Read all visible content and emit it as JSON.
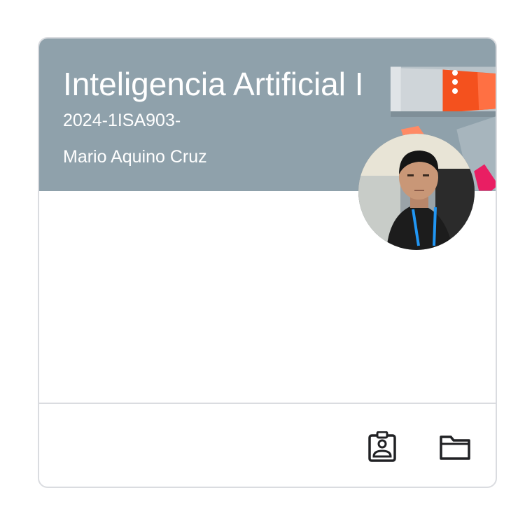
{
  "course": {
    "title": "Inteligencia Artificial I",
    "section": "2024-1ISA903-",
    "teacher": "Mario Aquino Cruz"
  },
  "icons": {
    "more": "more-vert-icon",
    "avatar": "teacher-avatar",
    "assignments": "assignment-ind-icon",
    "folder": "folder-icon"
  },
  "colors": {
    "banner": "#8fa1ab",
    "border": "#dadce0",
    "text_on_banner": "#ffffff",
    "icon": "#202124",
    "accent_orange": "#f4511e",
    "accent_pink": "#e91e63"
  }
}
